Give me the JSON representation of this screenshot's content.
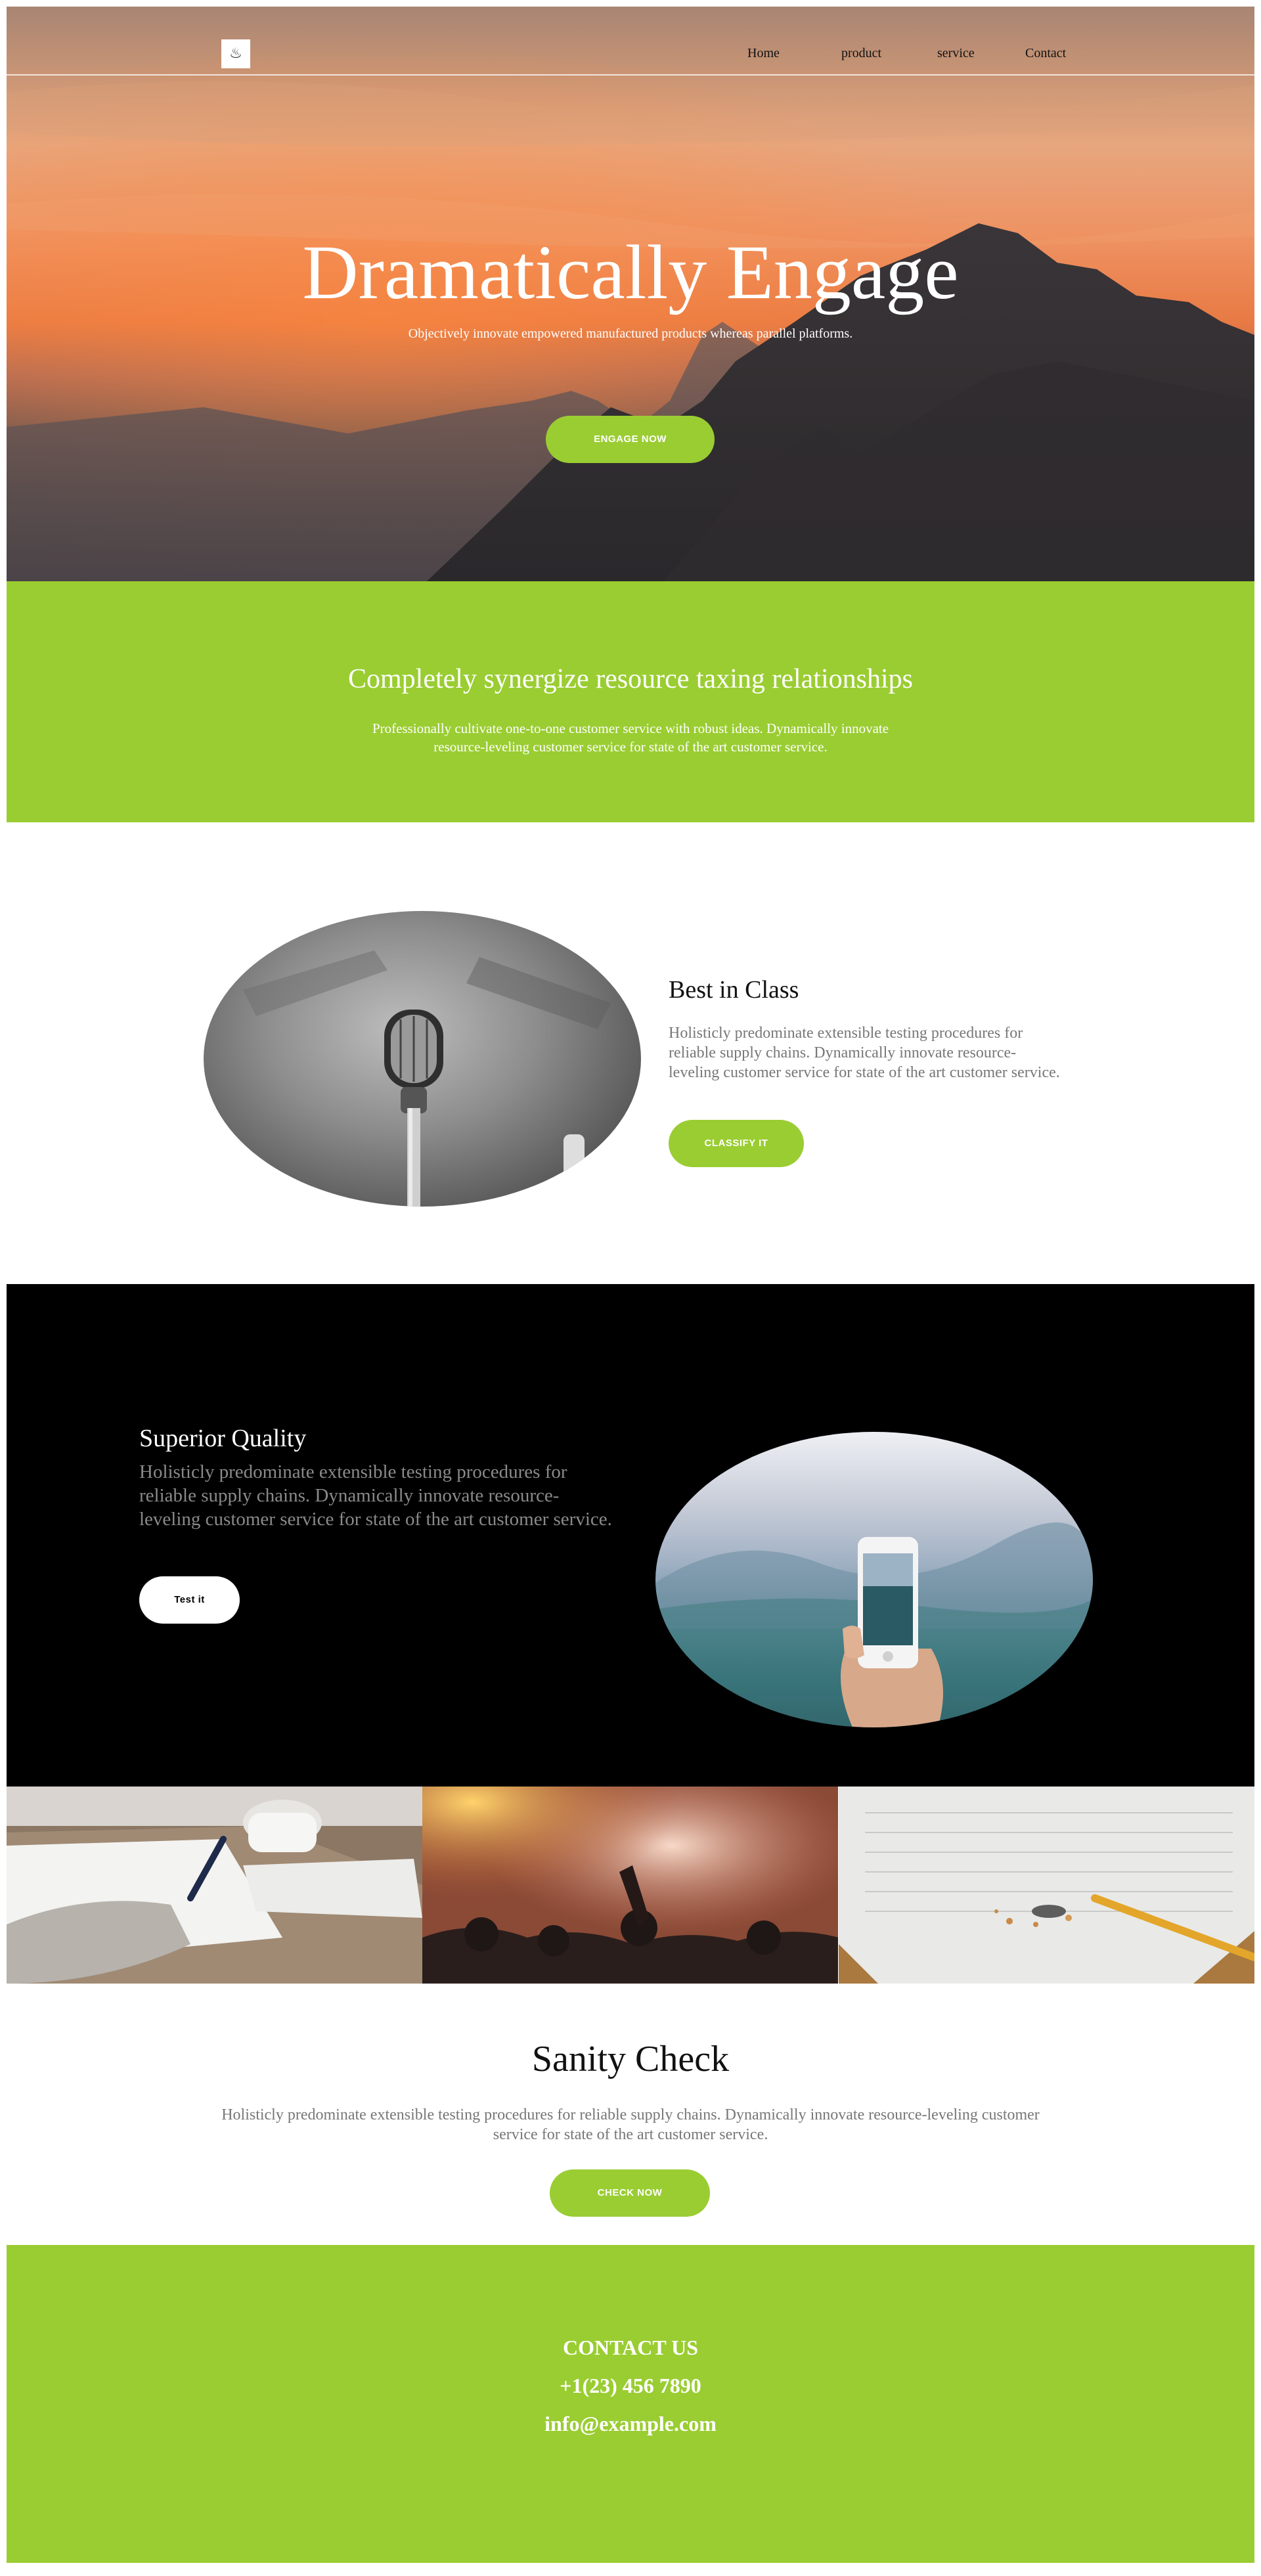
{
  "nav": {
    "logo_glyph": "♨",
    "items": [
      "Home",
      "product",
      "service",
      "Contact"
    ]
  },
  "hero": {
    "title": "Dramatically Engage",
    "subtitle": "Objectively innovate empowered manufactured products whereas parallel platforms.",
    "button": "ENGAGE NOW"
  },
  "band": {
    "title": "Completely synergize resource taxing relationships",
    "text": "Professionally cultivate one-to-one customer service with robust ideas. Dynamically innovate resource-leveling customer service for state of the art customer service."
  },
  "feature1": {
    "title": "Best in Class",
    "text": "Holisticly predominate extensible testing procedures for reliable supply chains. Dynamically innovate resource-leveling customer service for state of the art customer service.",
    "button": "CLASSIFY IT"
  },
  "feature2": {
    "title": "Superior Quality",
    "text": "Holisticly predominate extensible testing procedures for reliable supply chains. Dynamically innovate resource-leveling customer service for state of the art customer service.",
    "button": "Test it"
  },
  "sanity": {
    "title": "Sanity Check",
    "text": "Holisticly predominate extensible testing procedures for reliable supply chains. Dynamically innovate resource-leveling customer service for state of the art customer service.",
    "button": "CHECK NOW"
  },
  "contact": {
    "heading": "CONTACT US",
    "phone": "+1(23) 456 7890",
    "email": "info@example.com"
  },
  "colors": {
    "accent": "#9acd32",
    "dark": "#000000",
    "muted_text": "#777777"
  }
}
